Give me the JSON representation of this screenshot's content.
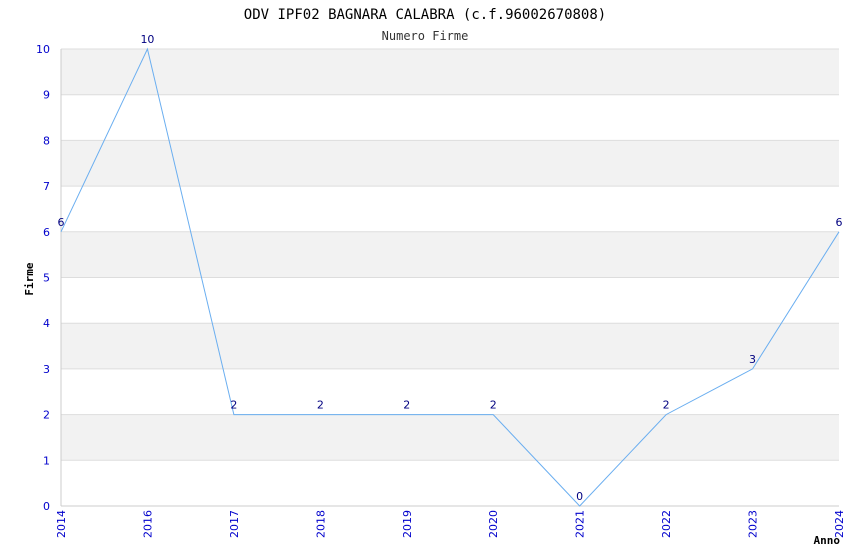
{
  "chart_data": {
    "type": "line",
    "title": "ODV IPF02 BAGNARA CALABRA (c.f.96002670808)",
    "subtitle": "Numero Firme",
    "xlabel": "Anno",
    "ylabel": "Firme",
    "categories": [
      "2014",
      "2016",
      "2017",
      "2018",
      "2019",
      "2020",
      "2021",
      "2022",
      "2023",
      "2024"
    ],
    "series": [
      {
        "values": [
          6,
          10,
          2,
          2,
          2,
          2,
          0,
          2,
          3,
          6
        ]
      }
    ],
    "ylim": [
      0,
      10
    ],
    "yticks": [
      0,
      1,
      2,
      3,
      4,
      5,
      6,
      7,
      8,
      9,
      10
    ],
    "grid": true,
    "colors": {
      "line": "#6aaef0",
      "band": "#f2f2f2",
      "grid": "#dddddd",
      "tick": "#0000cc",
      "data_label": "#000080"
    }
  }
}
